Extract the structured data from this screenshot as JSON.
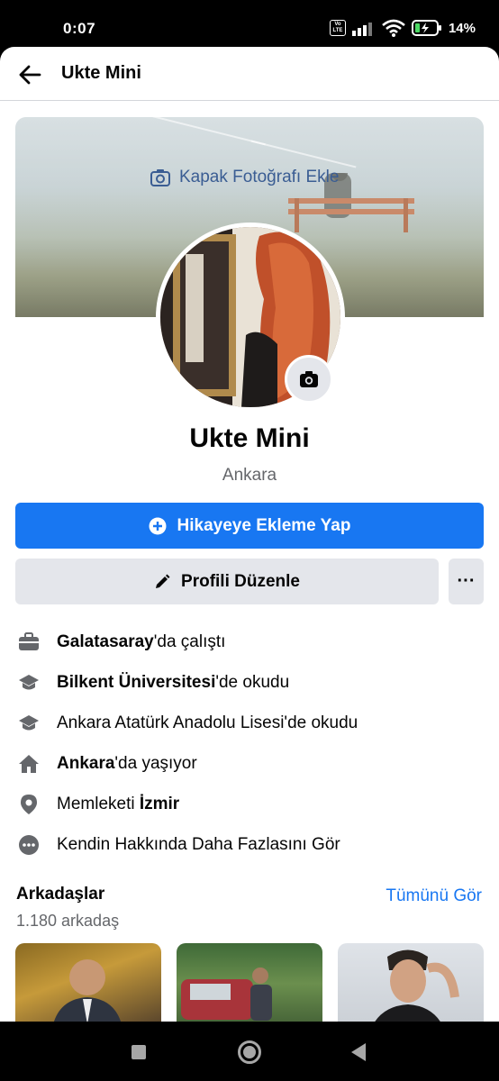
{
  "status_bar": {
    "time": "0:07",
    "battery": "14%",
    "volte": "Vo LTE"
  },
  "header": {
    "title": "Ukte Mini"
  },
  "cover": {
    "add_label": "Kapak Fotoğrafı Ekle"
  },
  "profile": {
    "name": "Ukte Mini",
    "location": "Ankara"
  },
  "actions": {
    "add_story": "Hikayeye Ekleme Yap",
    "edit_profile": "Profili Düzenle",
    "more": "···"
  },
  "details": [
    {
      "icon": "briefcase-icon",
      "bold": "Galatasaray",
      "rest": "'da çalıştı"
    },
    {
      "icon": "graduation-cap-icon",
      "bold": "Bilkent Üniversitesi",
      "rest": "'de okudu"
    },
    {
      "icon": "graduation-cap-icon",
      "bold": "",
      "rest": "Ankara Atatürk Anadolu Lisesi'de okudu"
    },
    {
      "icon": "home-icon",
      "bold": "Ankara",
      "rest": "'da yaşıyor"
    },
    {
      "icon": "location-pin-icon",
      "pre": "Memleketi ",
      "bold": "İzmir",
      "rest": ""
    },
    {
      "icon": "more-circle-icon",
      "bold": "",
      "rest": "Kendin Hakkında Daha Fazlasını Gör"
    }
  ],
  "friends": {
    "title": "Arkadaşlar",
    "count": "1.180 arkadaş",
    "see_all": "Tümünü Gör"
  },
  "colors": {
    "primary": "#1877f2",
    "secondary_bg": "#e4e6eb",
    "muted_text": "#65676b"
  }
}
